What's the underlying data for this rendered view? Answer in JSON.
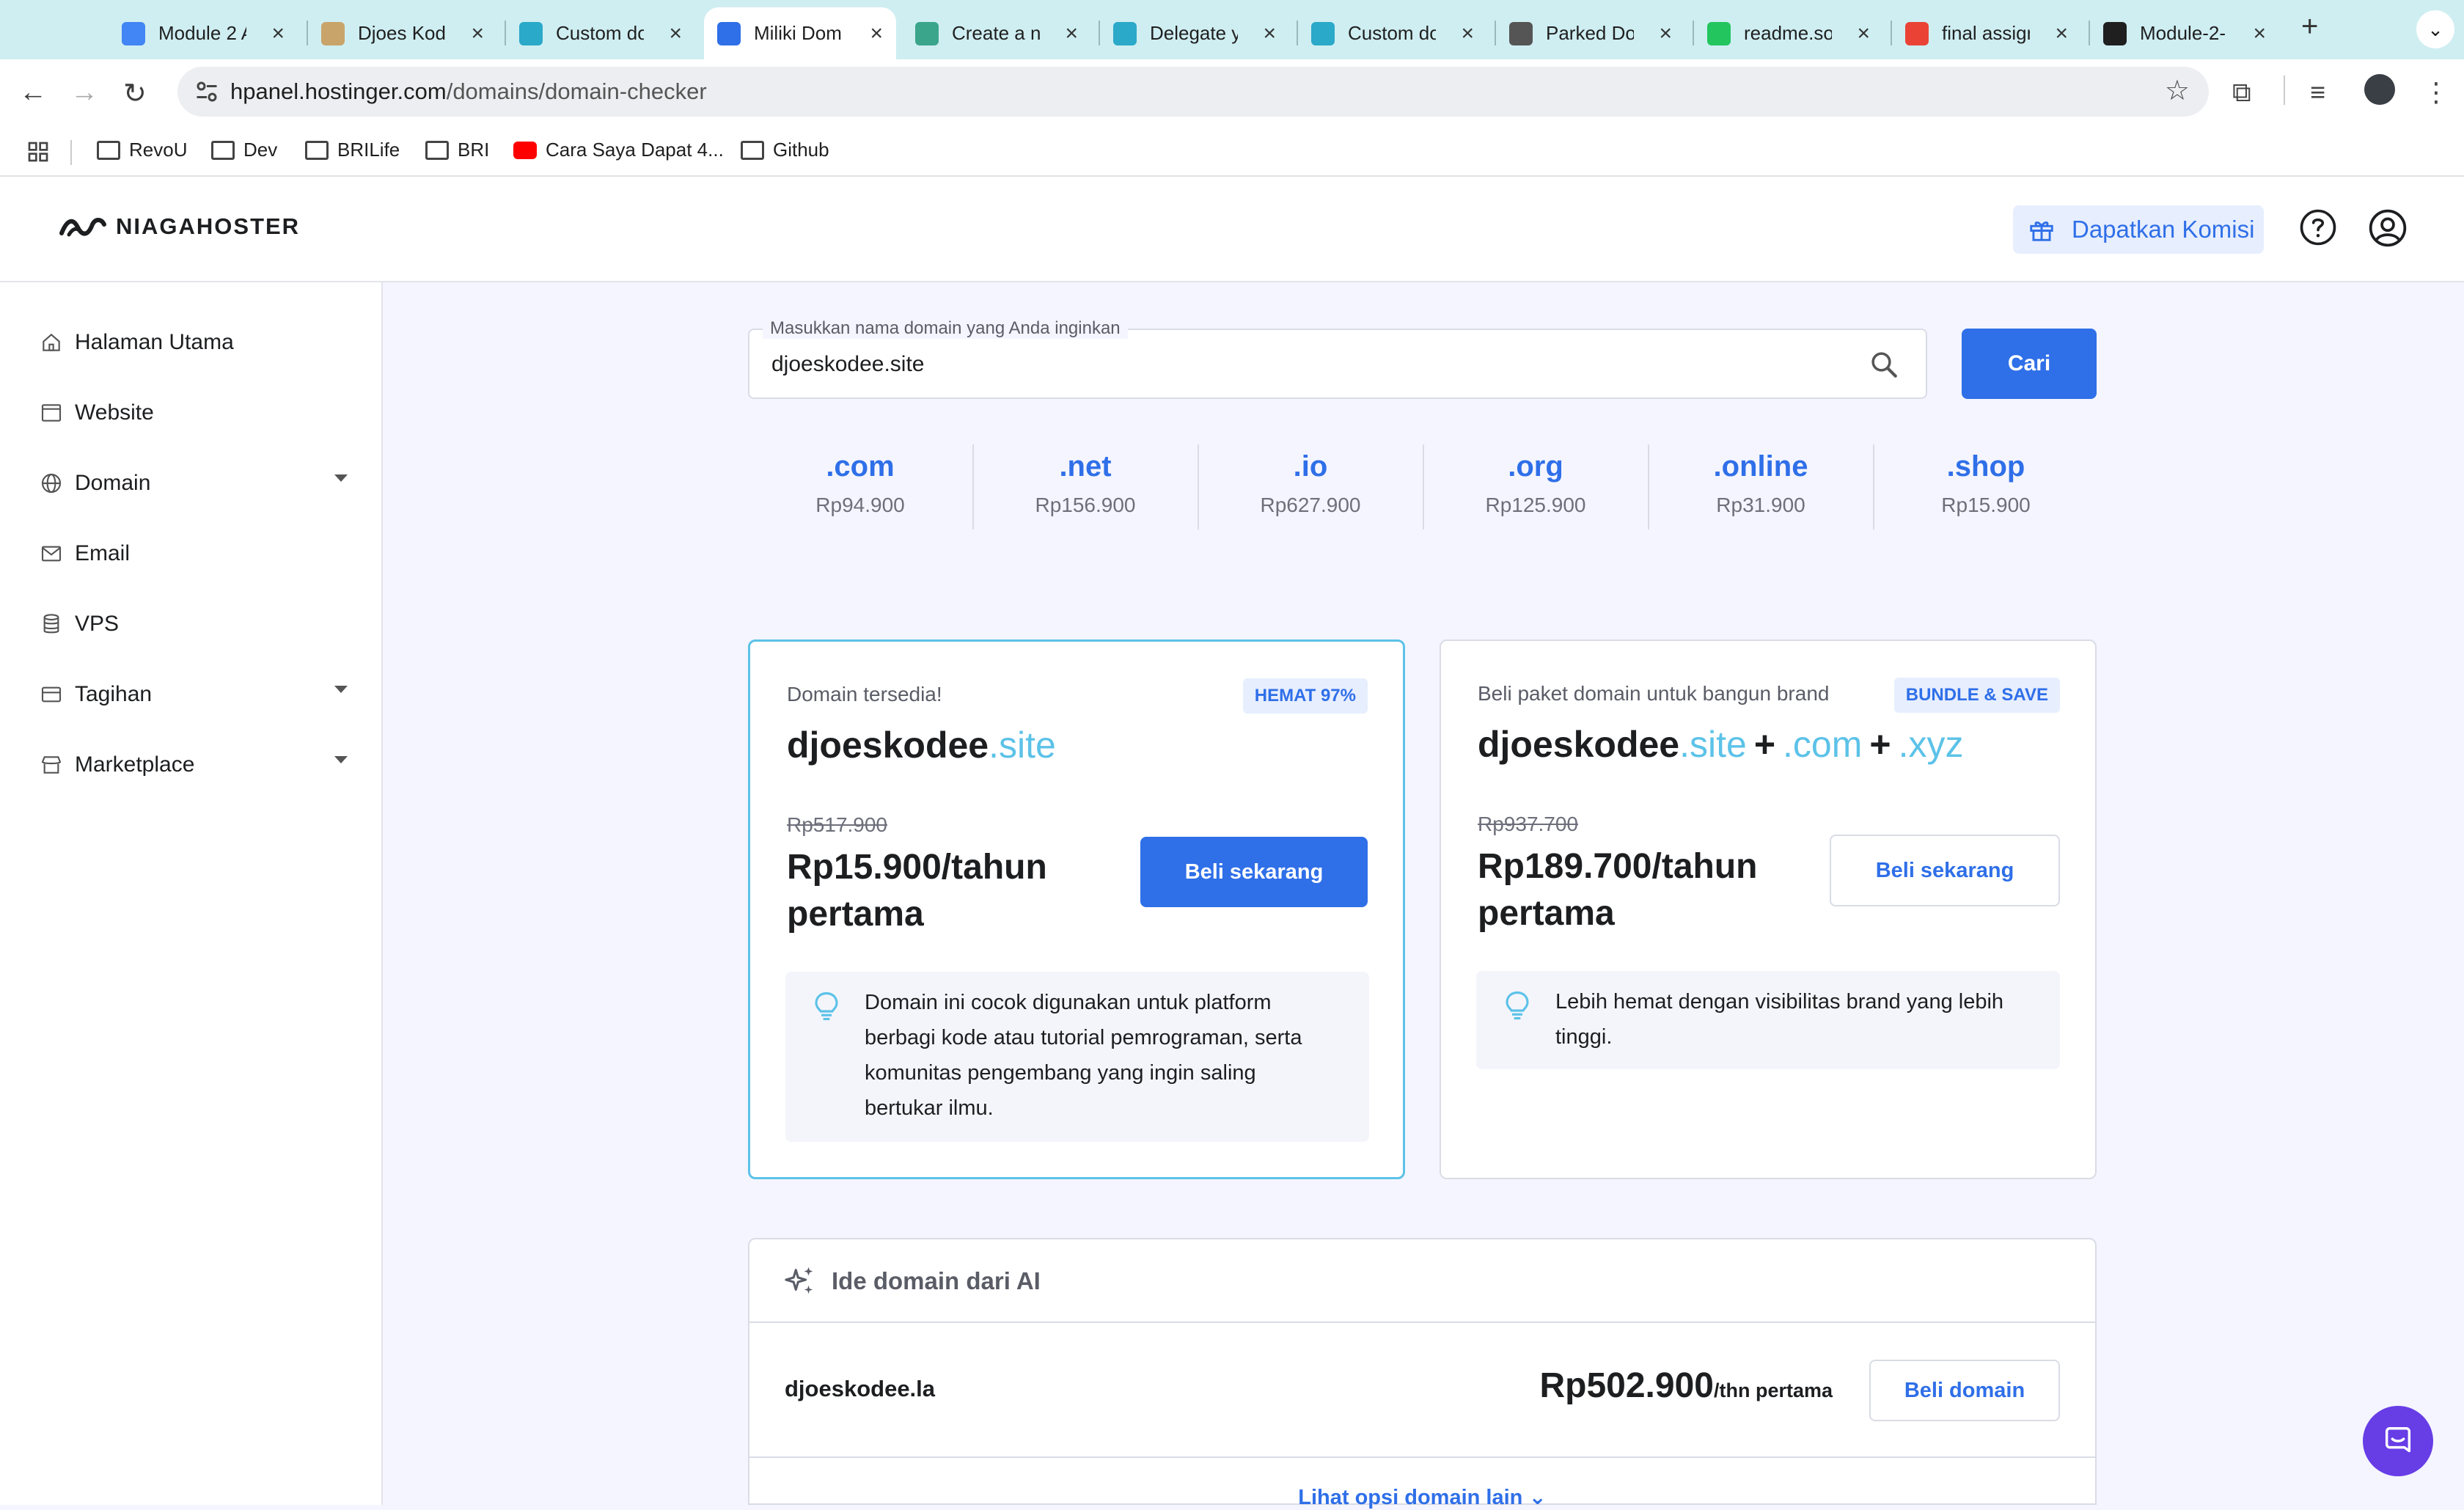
{
  "browser": {
    "tabs": [
      {
        "title": "Module 2 A",
        "favicon_color": "#4285f4"
      },
      {
        "title": "Djoes Kode",
        "favicon_color": "#c9a46a"
      },
      {
        "title": "Custom do",
        "favicon_color": "#2aa9c9"
      },
      {
        "title": "Miliki Doma",
        "favicon_color": "#2f6fe8",
        "active": true
      },
      {
        "title": "Create a ne",
        "favicon_color": "#3aa58b"
      },
      {
        "title": "Delegate yo",
        "favicon_color": "#2aa9c9"
      },
      {
        "title": "Custom do",
        "favicon_color": "#2aa9c9"
      },
      {
        "title": "Parked Dor",
        "favicon_color": "#555555"
      },
      {
        "title": "readme.so",
        "favicon_color": "#22c55e"
      },
      {
        "title": "final assign",
        "favicon_color": "#ea4335"
      },
      {
        "title": "Module-2-",
        "favicon_color": "#1f1f1f"
      }
    ],
    "url_host": "hpanel.hostinger.com",
    "url_path": "/domains/domain-checker",
    "bookmarks": [
      {
        "label": "RevoU",
        "icon": "folder-icon"
      },
      {
        "label": "Dev",
        "icon": "folder-icon"
      },
      {
        "label": "BRILife",
        "icon": "folder-icon"
      },
      {
        "label": "BRI",
        "icon": "folder-icon"
      },
      {
        "label": "Cara Saya Dapat 4...",
        "icon": "youtube-icon"
      },
      {
        "label": "Github",
        "icon": "folder-icon"
      }
    ]
  },
  "header": {
    "brand": "NIAGAHOSTER",
    "commission_label": "Dapatkan Komisi"
  },
  "sidebar": {
    "items": [
      {
        "label": "Halaman Utama",
        "icon": "home-icon",
        "has_caret": false
      },
      {
        "label": "Website",
        "icon": "browser-window-icon",
        "has_caret": false
      },
      {
        "label": "Domain",
        "icon": "globe-icon",
        "has_caret": true
      },
      {
        "label": "Email",
        "icon": "mail-icon",
        "has_caret": false
      },
      {
        "label": "VPS",
        "icon": "server-icon",
        "has_caret": false
      },
      {
        "label": "Tagihan",
        "icon": "credit-card-icon",
        "has_caret": true
      },
      {
        "label": "Marketplace",
        "icon": "store-icon",
        "has_caret": true
      }
    ]
  },
  "search": {
    "label": "Masukkan nama domain yang Anda inginkan",
    "value": "djoeskodee.site",
    "button": "Cari"
  },
  "tlds": [
    {
      "name": ".com",
      "price": "Rp94.900"
    },
    {
      "name": ".net",
      "price": "Rp156.900"
    },
    {
      "name": ".io",
      "price": "Rp627.900"
    },
    {
      "name": ".org",
      "price": "Rp125.900"
    },
    {
      "name": ".online",
      "price": "Rp31.900"
    },
    {
      "name": ".shop",
      "price": "Rp15.900"
    }
  ],
  "available_card": {
    "heading": "Domain tersedia!",
    "badge": "HEMAT 97%",
    "domain_base": "djoeskodee",
    "domain_tld": ".site",
    "old_price": "Rp517.900",
    "price": "Rp15.900/tahun pertama",
    "button": "Beli sekarang",
    "tip": "Domain ini cocok digunakan untuk platform berbagi kode atau tutorial pemrograman, serta komunitas pengembang yang ingin saling bertukar ilmu."
  },
  "bundle_card": {
    "heading": "Beli paket domain untuk bangun brand",
    "badge": "BUNDLE & SAVE",
    "domain_base": "djoeskodee",
    "tlds": [
      ".site",
      ".com",
      ".xyz"
    ],
    "plus": "+",
    "old_price": "Rp937.700",
    "price": "Rp189.700/tahun pertama",
    "button": "Beli sekarang",
    "tip": "Lebih hemat dengan visibilitas brand yang lebih tinggi."
  },
  "ai_ideas": {
    "title": "Ide domain dari AI",
    "domain": "djoeskodee.la",
    "price": "Rp502.900",
    "price_suffix": "/thn pertama",
    "button": "Beli domain",
    "more": "Lihat opsi domain lain"
  },
  "colors": {
    "accent": "#2f6fe8",
    "tld_highlight": "#5cc2e8",
    "chat": "#673de6"
  }
}
